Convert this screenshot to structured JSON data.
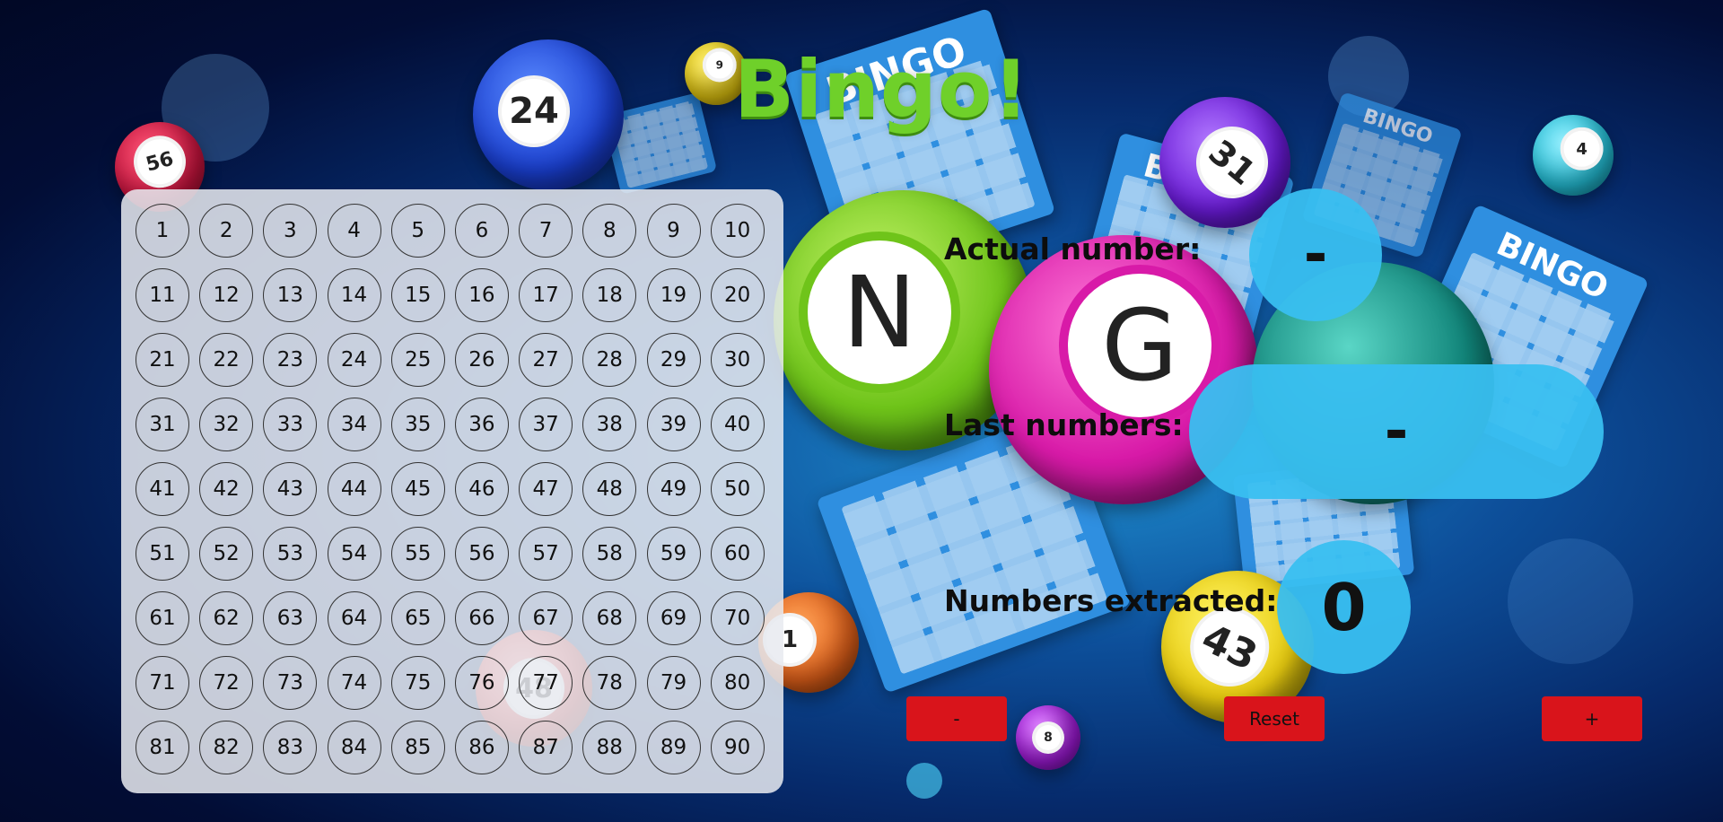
{
  "app": {
    "title": "Bingo!"
  },
  "board": {
    "rows": [
      [
        1,
        2,
        3,
        4,
        5,
        6,
        7,
        8,
        9,
        10
      ],
      [
        11,
        12,
        13,
        14,
        15,
        16,
        17,
        18,
        19,
        20
      ],
      [
        21,
        22,
        23,
        24,
        25,
        26,
        27,
        28,
        29,
        30
      ],
      [
        31,
        32,
        33,
        34,
        35,
        36,
        37,
        38,
        39,
        40
      ],
      [
        41,
        42,
        43,
        44,
        45,
        46,
        47,
        48,
        49,
        50
      ],
      [
        51,
        52,
        53,
        54,
        55,
        56,
        57,
        58,
        59,
        60
      ],
      [
        61,
        62,
        63,
        64,
        65,
        66,
        67,
        68,
        69,
        70
      ],
      [
        71,
        72,
        73,
        74,
        75,
        76,
        77,
        78,
        79,
        80
      ],
      [
        81,
        82,
        83,
        84,
        85,
        86,
        87,
        88,
        89,
        90
      ]
    ]
  },
  "panel": {
    "actual_label": "Actual number:",
    "actual_value": "-",
    "last_label": "Last numbers:",
    "last_value": "-",
    "extracted_label": "Numbers extracted:",
    "extracted_value": "0"
  },
  "controls": {
    "minus_label": "-",
    "reset_label": "Reset",
    "plus_label": "+"
  },
  "colors": {
    "accent": "#39bff0",
    "button": "#d9141b",
    "title": "#6fd02a"
  }
}
